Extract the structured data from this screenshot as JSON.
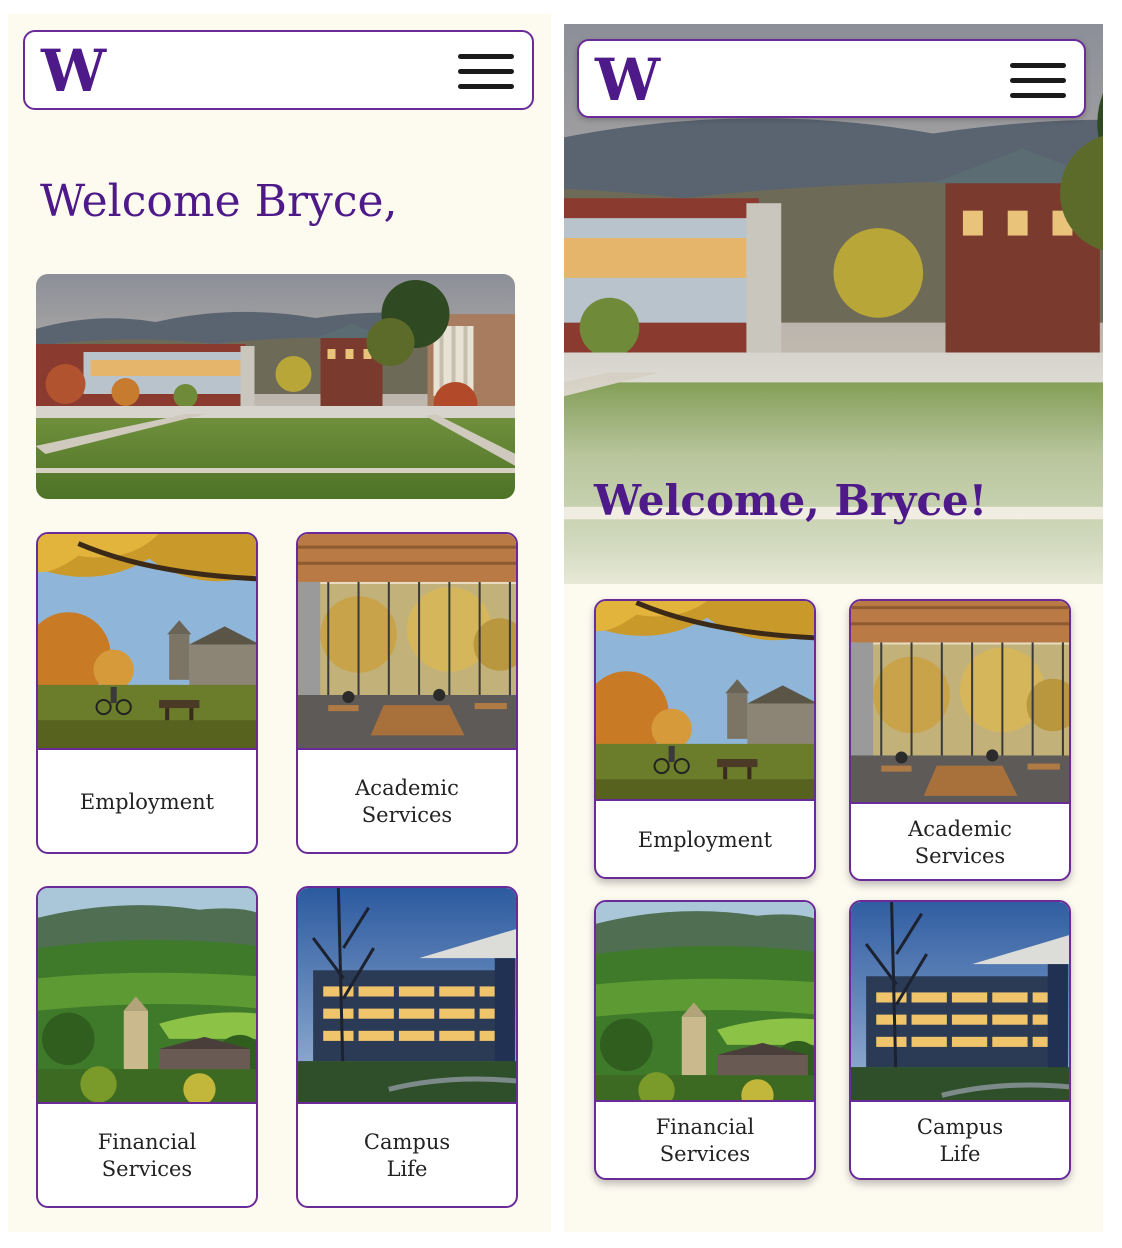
{
  "brand": {
    "logo_letter": "W",
    "primary_color": "#4e1a8a",
    "border_color": "#6a2b99",
    "background_color": "#fdfaf0"
  },
  "screen_a": {
    "menu_icon": "hamburger-menu-icon",
    "welcome": "Welcome Bryce,",
    "cards": [
      {
        "label": "Employment",
        "image": "autumn-campus-lawn-photo"
      },
      {
        "label": "Academic\nServices",
        "image": "library-glass-study-hall-photo"
      },
      {
        "label": "Financial\nServices",
        "image": "green-valley-chapel-photo"
      },
      {
        "label": "Campus\nLife",
        "image": "modern-library-building-dusk-photo"
      }
    ]
  },
  "screen_b": {
    "menu_icon": "hamburger-menu-icon",
    "welcome": "Welcome, Bryce!",
    "cards": [
      {
        "label": "Employment",
        "image": "autumn-campus-lawn-photo"
      },
      {
        "label": "Academic\nServices",
        "image": "library-glass-study-hall-photo"
      },
      {
        "label": "Financial\nServices",
        "image": "green-valley-chapel-photo"
      },
      {
        "label": "Campus\nLife",
        "image": "modern-library-building-dusk-photo"
      }
    ]
  }
}
